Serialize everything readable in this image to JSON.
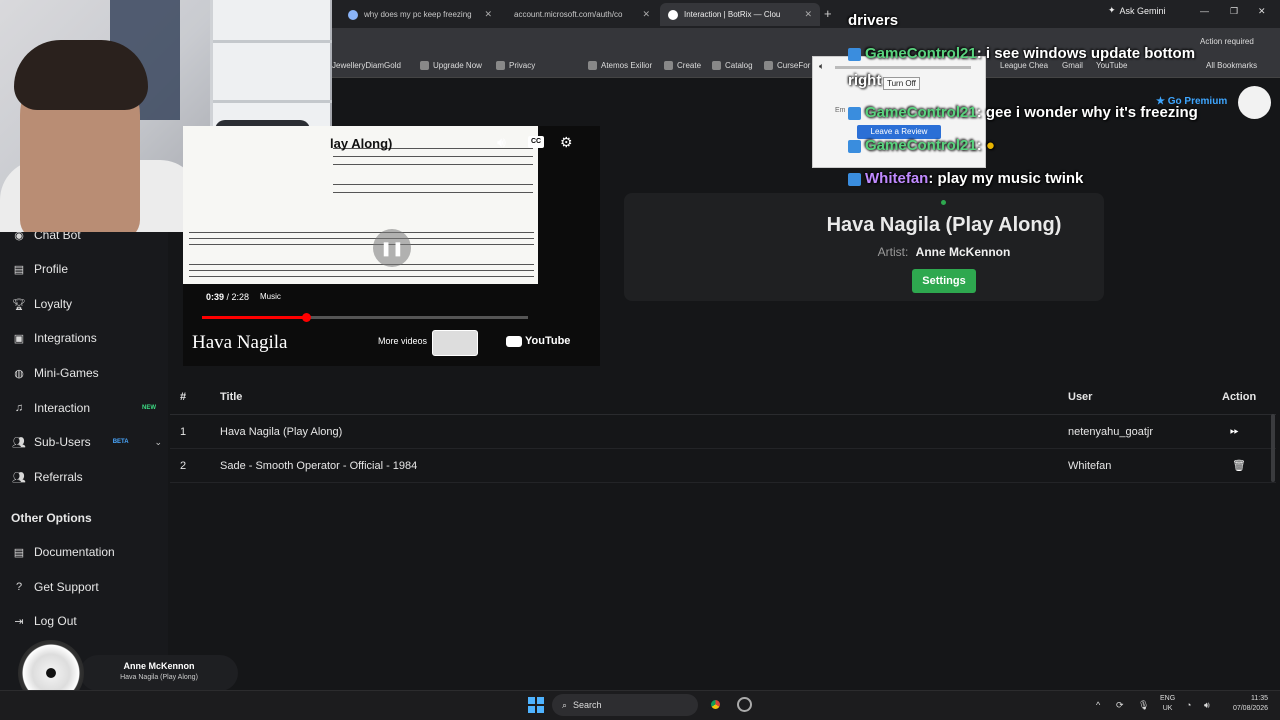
{
  "browser": {
    "tabs": [
      {
        "label": "why does my pc keep freezing",
        "active": false
      },
      {
        "label": "account.microsoft.com/auth/co",
        "active": false
      },
      {
        "label": "Interaction | BotRix — Clou",
        "active": true
      }
    ],
    "ask_gemini": "Ask Gemini",
    "action_required": "Action required",
    "bookmarks": [
      "JewelleryDiamGold",
      "Upgrade Now",
      "Privacy",
      "Atemos Exilior",
      "Create",
      "Catalog",
      "CurseFor",
      "League Chea",
      "Gmail",
      "YouTube",
      "All Bookmarks"
    ]
  },
  "sidebar": {
    "items": [
      {
        "label": "Chat Bot",
        "icon": "chat-bot-icon"
      },
      {
        "label": "Profile",
        "icon": "profile-icon"
      },
      {
        "label": "Loyalty",
        "icon": "trophy-icon"
      },
      {
        "label": "Integrations",
        "icon": "integrations-icon"
      },
      {
        "label": "Mini-Games",
        "icon": "gamepad-icon"
      },
      {
        "label": "Interaction",
        "icon": "music-note-icon",
        "badge": "NEW"
      },
      {
        "label": "Sub-Users",
        "icon": "users-icon",
        "badge": "BETA"
      },
      {
        "label": "Referrals",
        "icon": "referrals-icon"
      }
    ],
    "other_options_title": "Other Options",
    "other_items": [
      {
        "label": "Documentation",
        "icon": "document-icon"
      },
      {
        "label": "Get Support",
        "icon": "help-icon"
      },
      {
        "label": "Log Out",
        "icon": "logout-icon"
      }
    ],
    "player": {
      "artist": "Anne McKennon",
      "title": "Hava Nagila (Play Along)"
    }
  },
  "video": {
    "title": "lay Along)",
    "time_current": "0:39",
    "time_total": "2:28",
    "chapter": "Music",
    "progress": 0.32,
    "overlay_title": "Hava Nagila",
    "more_videos": "More videos",
    "youtube": "YouTube"
  },
  "now_playing": {
    "title": "Hava Nagila (Play Along)",
    "artist_label": "Artist:",
    "artist": "Anne McKennon",
    "settings_label": "Settings"
  },
  "header": {
    "go_premium": "Go Premium"
  },
  "queue": {
    "columns": [
      "#",
      "Title",
      "User",
      "Action"
    ],
    "rows": [
      {
        "num": "1",
        "title": "Hava Nagila (Play Along)",
        "user": "netenyahu_goatjr",
        "action": "skip"
      },
      {
        "num": "2",
        "title": "Sade - Smooth Operator - Official - 1984",
        "user": "Whitefan",
        "action": "delete"
      }
    ]
  },
  "popup": {
    "turn_off": "Turn Off",
    "em": "Em",
    "review": "Leave a Review"
  },
  "chat": [
    {
      "user": "",
      "text": "drivers"
    },
    {
      "user": "GameControl21",
      "text": ": i see windows update bottom"
    },
    {
      "user": "",
      "text": "right"
    },
    {
      "user": "GameControl21",
      "text": ": gee i wonder why it's freezing"
    },
    {
      "user": "GameControl21",
      "text": ":"
    },
    {
      "user": "Whitefan",
      "text": ": play my music twink"
    }
  ],
  "taskbar": {
    "search": "Search",
    "lang_top": "ENG",
    "lang_bottom": "UK",
    "time": "11:35",
    "date": "07/08/2026"
  },
  "colors": {
    "accent_green": "#2ea84f",
    "premium_blue": "#3ea6ff",
    "chat_user_green": "#59d37e",
    "chat_user_purple": "#c08aff"
  }
}
